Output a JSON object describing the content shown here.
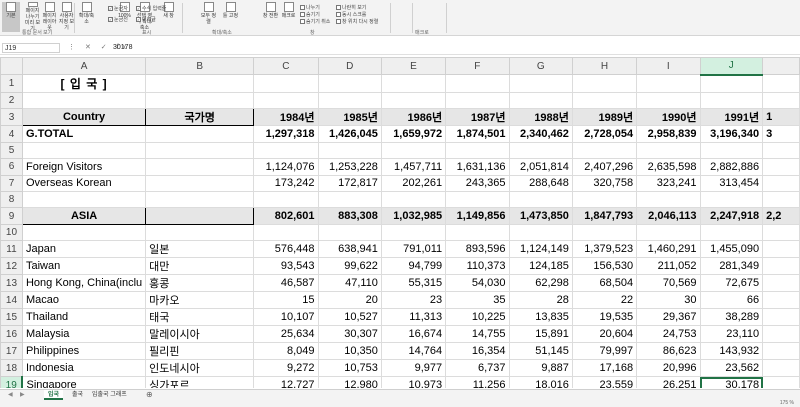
{
  "ribbon": {
    "buttons": [
      {
        "label": "기본",
        "icon": "normal-view-icon"
      },
      {
        "label": "페이지 나누기 미리 보기",
        "icon": "page-break-icon"
      },
      {
        "label": "페이지 레이아웃",
        "icon": "page-layout-icon"
      },
      {
        "label": "사용자 지정 보기",
        "icon": "custom-view-icon"
      },
      {
        "label": "확대/축소",
        "icon": "zoom-icon"
      },
      {
        "label": "100%",
        "icon": "zoom-100-icon"
      },
      {
        "label": "선택 영역 확대/축소",
        "icon": "zoom-selection-icon"
      },
      {
        "label": "새 창",
        "icon": "new-window-icon"
      },
      {
        "label": "모두 정렬",
        "icon": "arrange-all-icon"
      },
      {
        "label": "틀 고정",
        "icon": "freeze-panes-icon"
      },
      {
        "label": "창 전환",
        "icon": "switch-window-icon"
      },
      {
        "label": "매크로",
        "icon": "macro-icon"
      }
    ],
    "checks": [
      "눈금자",
      "수식 입력줄",
      "눈금선",
      "머리글",
      "나누기",
      "숨기기",
      "숨기기 취소",
      "나란히 보기",
      "동시 스크롤",
      "창 위치 다시 정렬"
    ],
    "groups": [
      "통합 문서 보기",
      "표시",
      "확대/축소",
      "창",
      "매크로"
    ]
  },
  "formula_bar": {
    "name_box": "J19",
    "icons": "⋮ ✕ ✓ fx",
    "value": "30178"
  },
  "columns": [
    "A",
    "B",
    "C",
    "D",
    "E",
    "F",
    "G",
    "H",
    "I",
    "J"
  ],
  "rows": [
    {
      "n": "1",
      "a": "[ 입 국 ]",
      "b": "",
      "v": [
        "",
        "",
        "",
        "",
        "",
        "",
        "",
        ""
      ]
    },
    {
      "n": "2",
      "a": "",
      "b": "",
      "v": [
        "",
        "",
        "",
        "",
        "",
        "",
        "",
        ""
      ]
    },
    {
      "n": "3",
      "a": "Country",
      "b": "국가명",
      "v": [
        "1984년",
        "1985년",
        "1986년",
        "1987년",
        "1988년",
        "1989년",
        "1990년",
        "1991년"
      ]
    },
    {
      "n": "4",
      "a": "G.TOTAL",
      "b": "",
      "v": [
        "1,297,318",
        "1,426,045",
        "1,659,972",
        "1,874,501",
        "2,340,462",
        "2,728,054",
        "2,958,839",
        "3,196,340"
      ]
    },
    {
      "n": "5",
      "a": "",
      "b": "",
      "v": [
        "",
        "",
        "",
        "",
        "",
        "",
        "",
        ""
      ]
    },
    {
      "n": "6",
      "a": "Foreign Visitors",
      "b": "",
      "v": [
        "1,124,076",
        "1,253,228",
        "1,457,711",
        "1,631,136",
        "2,051,814",
        "2,407,296",
        "2,635,598",
        "2,882,886"
      ]
    },
    {
      "n": "7",
      "a": "Overseas Korean",
      "b": "",
      "v": [
        "173,242",
        "172,817",
        "202,261",
        "243,365",
        "288,648",
        "320,758",
        "323,241",
        "313,454"
      ]
    },
    {
      "n": "8",
      "a": "",
      "b": "",
      "v": [
        "",
        "",
        "",
        "",
        "",
        "",
        "",
        ""
      ]
    },
    {
      "n": "9",
      "a": "ASIA",
      "b": "",
      "v": [
        "802,601",
        "883,308",
        "1,032,985",
        "1,149,856",
        "1,473,850",
        "1,847,793",
        "2,046,113",
        "2,247,918"
      ]
    },
    {
      "n": "10",
      "a": "",
      "b": "",
      "v": [
        "",
        "",
        "",
        "",
        "",
        "",
        "",
        ""
      ]
    },
    {
      "n": "11",
      "a": "Japan",
      "b": "일본",
      "v": [
        "576,448",
        "638,941",
        "791,011",
        "893,596",
        "1,124,149",
        "1,379,523",
        "1,460,291",
        "1,455,090"
      ]
    },
    {
      "n": "12",
      "a": "Taiwan",
      "b": "대만",
      "v": [
        "93,543",
        "99,622",
        "94,799",
        "110,373",
        "124,185",
        "156,530",
        "211,052",
        "281,349"
      ]
    },
    {
      "n": "13",
      "a": "Hong Kong, China(inclu",
      "b": "홍콩",
      "v": [
        "46,587",
        "47,110",
        "55,315",
        "54,030",
        "62,298",
        "68,504",
        "70,569",
        "72,675"
      ]
    },
    {
      "n": "14",
      "a": "Macao",
      "b": "마카오",
      "v": [
        "15",
        "20",
        "23",
        "35",
        "28",
        "22",
        "30",
        "66"
      ]
    },
    {
      "n": "15",
      "a": "Thailand",
      "b": "태국",
      "v": [
        "10,107",
        "10,527",
        "11,313",
        "10,225",
        "13,835",
        "19,535",
        "29,367",
        "38,289"
      ]
    },
    {
      "n": "16",
      "a": "Malaysia",
      "b": "말레이시아",
      "v": [
        "25,634",
        "30,307",
        "16,674",
        "14,755",
        "15,891",
        "20,604",
        "24,753",
        "23,110"
      ]
    },
    {
      "n": "17",
      "a": "Philippines",
      "b": "필리핀",
      "v": [
        "8,049",
        "10,350",
        "14,764",
        "16,354",
        "51,145",
        "79,997",
        "86,623",
        "143,932"
      ]
    },
    {
      "n": "18",
      "a": "Indonesia",
      "b": "인도네시아",
      "v": [
        "9,272",
        "10,753",
        "9,977",
        "6,737",
        "9,887",
        "17,168",
        "20,996",
        "23,562"
      ]
    },
    {
      "n": "19",
      "a": "Singapore",
      "b": "싱가포르",
      "v": [
        "12,727",
        "12,980",
        "10,973",
        "11,256",
        "18,016",
        "23,559",
        "26,251",
        "30,178"
      ]
    }
  ],
  "overflow": {
    "row3": "1",
    "row4": "3",
    "row9": "2,2"
  },
  "sheet_tabs": [
    "입국",
    "출국",
    "입출국 그래프"
  ],
  "status": {
    "zoom": "175 %"
  },
  "colors": {
    "accent": "#217346",
    "shade": "#e6e6e6"
  }
}
